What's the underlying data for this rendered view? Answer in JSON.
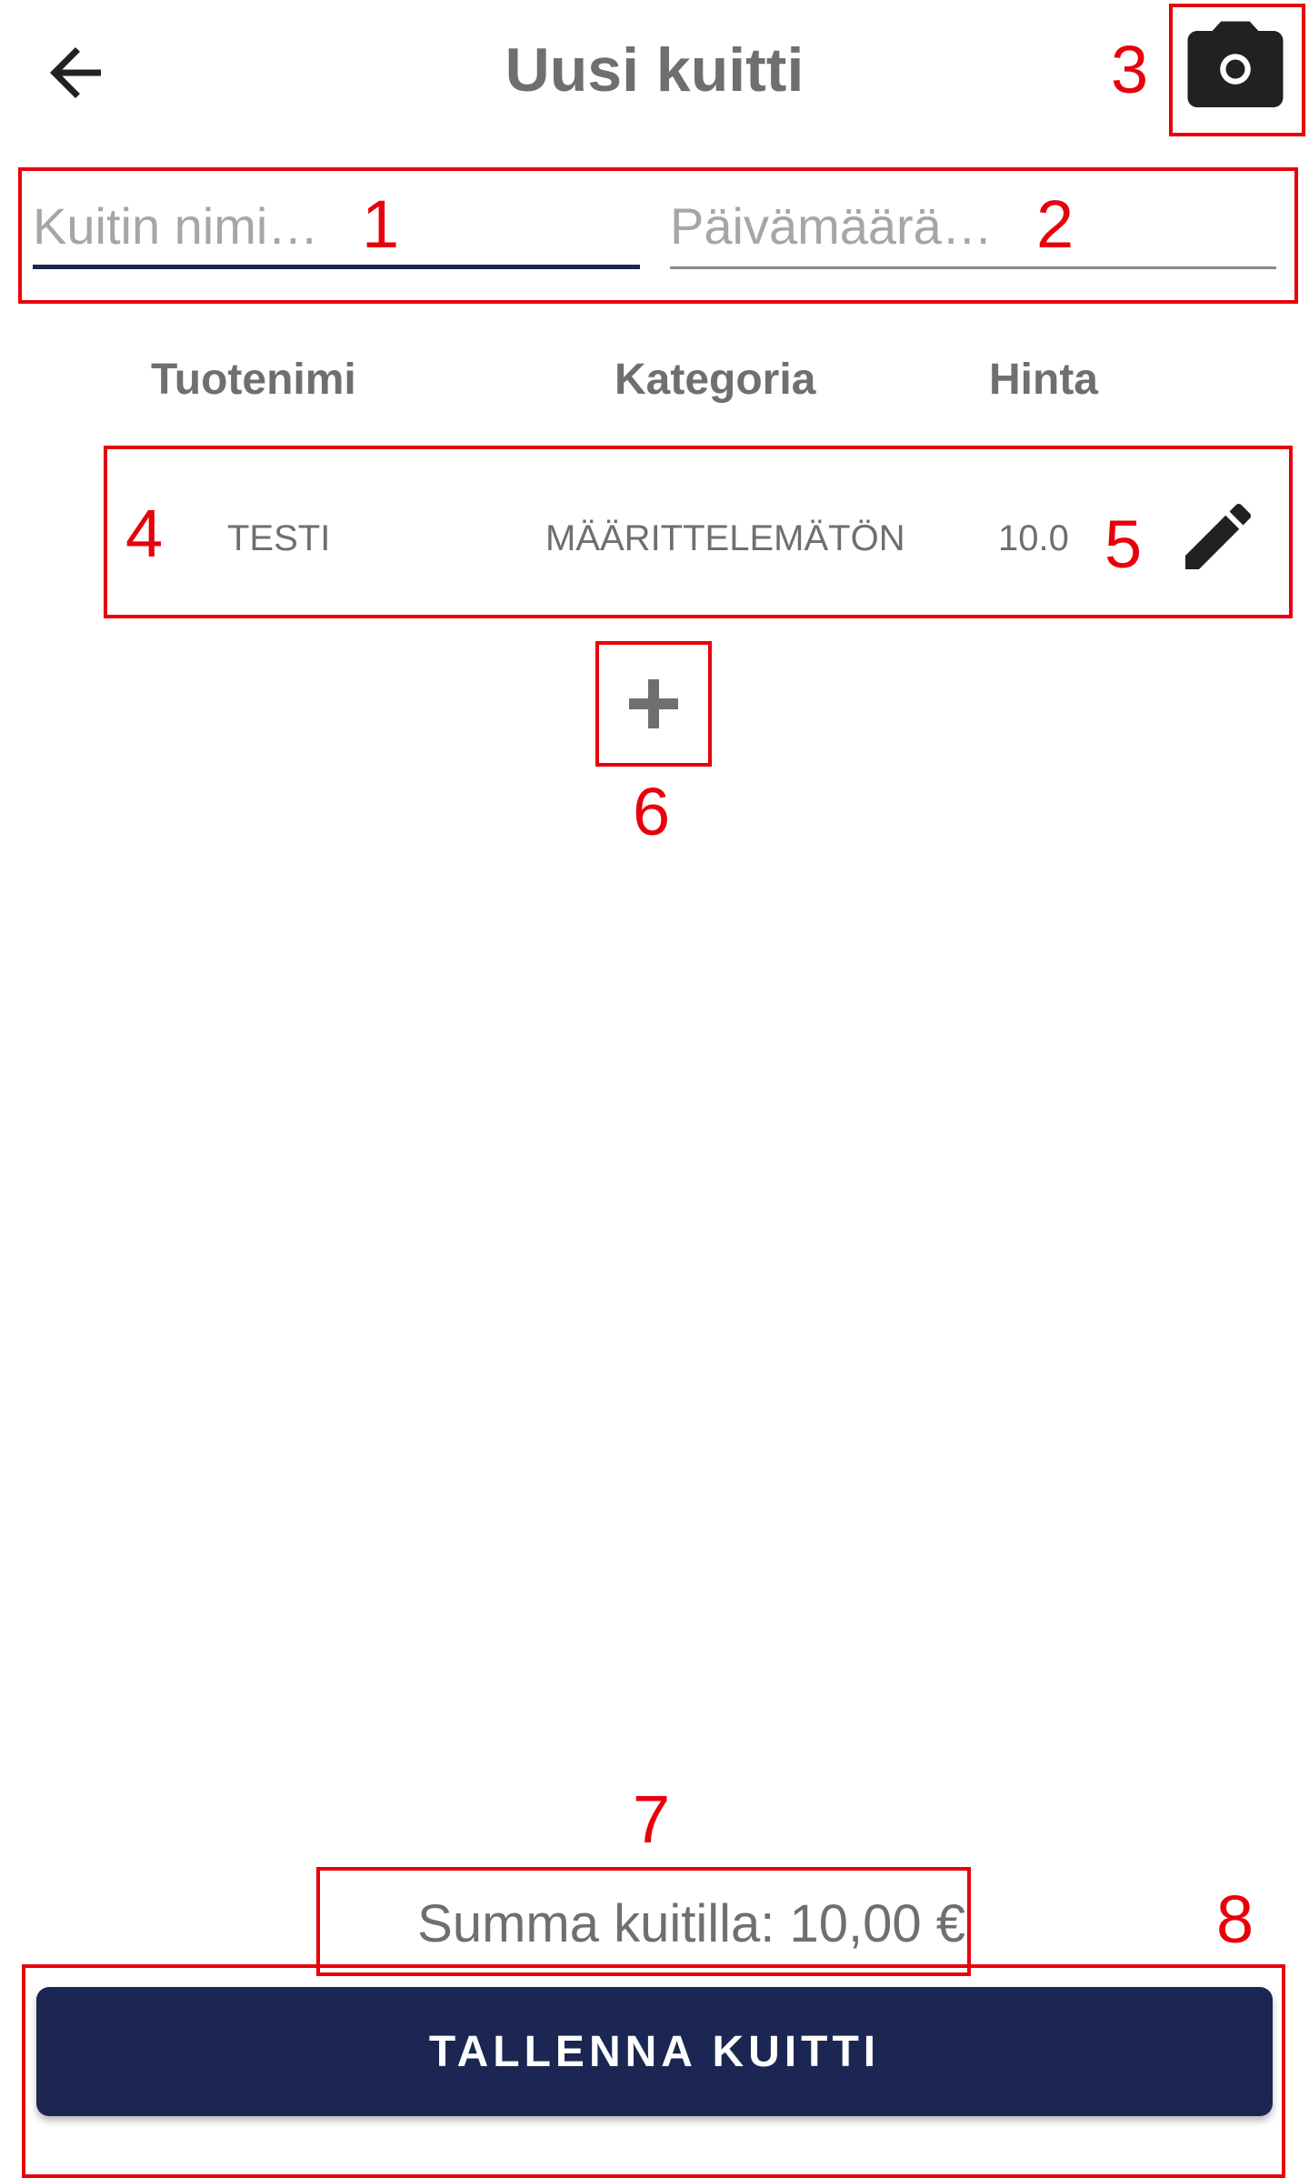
{
  "header": {
    "title": "Uusi kuitti",
    "back_icon": "arrow-left-icon",
    "camera_icon": "camera-icon"
  },
  "form": {
    "name_placeholder": "Kuitin nimi…",
    "date_placeholder": "Päivämäärä…"
  },
  "table": {
    "columns": [
      "Tuotenimi",
      "Kategoria",
      "Hinta"
    ],
    "rows": [
      {
        "name": "TESTI",
        "category": "MÄÄRITTELEMÄTÖN",
        "price": "10.0"
      }
    ],
    "edit_icon": "pencil-icon",
    "add_icon": "plus-icon"
  },
  "footer": {
    "total": "Summa kuitilla: 10,00 €",
    "save_label": "TALLENNA KUITTI"
  },
  "annotations": [
    "1",
    "2",
    "3",
    "4",
    "5",
    "6",
    "7",
    "8"
  ],
  "colors": {
    "primary": "#1b2752",
    "annotation": "#e8000b",
    "text_gray": "#6f6f6f"
  }
}
